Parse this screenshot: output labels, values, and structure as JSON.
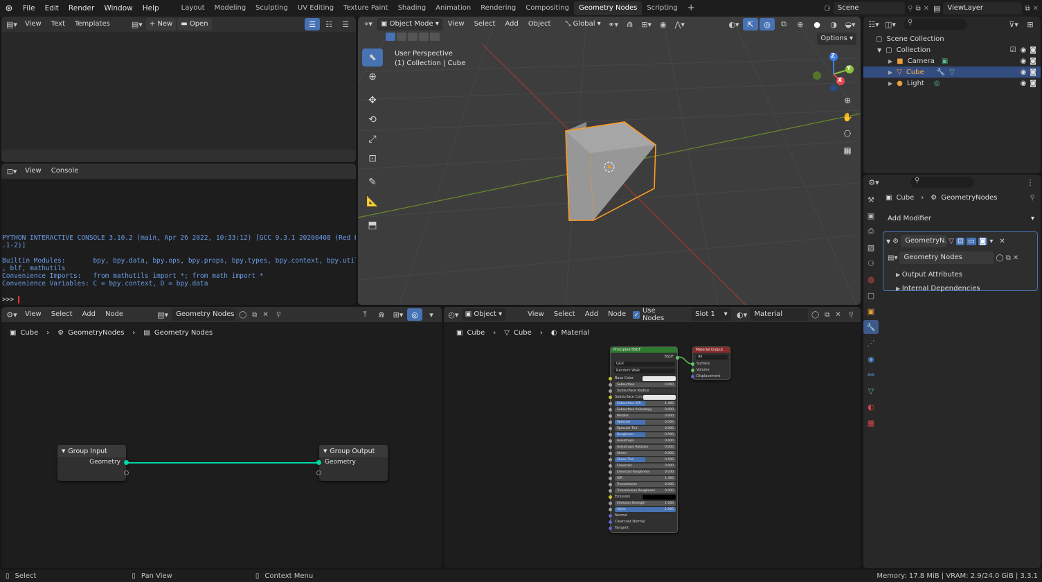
{
  "app": {
    "menus": [
      "File",
      "Edit",
      "Render",
      "Window",
      "Help"
    ],
    "workspaces": [
      "Layout",
      "Modeling",
      "Sculpting",
      "UV Editing",
      "Texture Paint",
      "Shading",
      "Animation",
      "Rendering",
      "Compositing",
      "Geometry Nodes",
      "Scripting"
    ],
    "active_workspace": "Geometry Nodes",
    "scene": "Scene",
    "view_layer": "ViewLayer",
    "add_workspace_icon": "+"
  },
  "text_editor": {
    "menus": [
      "View",
      "Text",
      "Templates"
    ],
    "new_label": "New",
    "open_label": "Open"
  },
  "console": {
    "menus": [
      "View",
      "Console"
    ],
    "lines": [
      "PYTHON INTERACTIVE CONSOLE 3.10.2 (main, Apr 26 2022, 10:33:12) [GCC 9.3.1 20200408 (Red Hat 9.3",
      ".1-2)]",
      "",
      "Builtin Modules:       bpy, bpy.data, bpy.ops, bpy.props, bpy.types, bpy.context, bpy.utils, bgl",
      ", blf, mathutils",
      "Convenience Imports:   from mathutils import *; from math import *",
      "Convenience Variables: C = bpy.context, D = bpy.data"
    ],
    "prompt": ">>>"
  },
  "viewport": {
    "mode": "Object Mode",
    "menus": [
      "View",
      "Select",
      "Add",
      "Object"
    ],
    "orientation": "Global",
    "options_label": "Options",
    "overlay_title": "User Perspective",
    "overlay_subtitle": "(1) Collection | Cube",
    "gizmo": {
      "x": "X",
      "y": "Y",
      "z": "Z"
    }
  },
  "outliner": {
    "scene_collection": "Scene Collection",
    "collection": "Collection",
    "items": [
      "Camera",
      "Cube",
      "Light"
    ],
    "selected": "Cube"
  },
  "properties": {
    "breadcrumb": [
      "Cube",
      "GeometryNodes"
    ],
    "add_modifier": "Add Modifier",
    "modifier_name": "GeometryN...",
    "node_group": "Geometry Nodes",
    "panels": [
      "Output Attributes",
      "Internal Dependencies"
    ]
  },
  "geo_editor": {
    "menus": [
      "View",
      "Select",
      "Add",
      "Node"
    ],
    "node_tree": "Geometry Nodes",
    "breadcrumb": [
      "Cube",
      "GeometryNodes",
      "Geometry Nodes"
    ],
    "group_input": {
      "title": "Group Input",
      "socket": "Geometry"
    },
    "group_output": {
      "title": "Group Output",
      "socket": "Geometry"
    }
  },
  "shader_editor": {
    "object_type": "Object",
    "menus": [
      "View",
      "Select",
      "Add",
      "Node"
    ],
    "use_nodes_label": "Use Nodes",
    "use_nodes": true,
    "slot": "Slot 1",
    "material": "Material",
    "breadcrumb": [
      "Cube",
      "Cube",
      "Material"
    ],
    "bsdf": {
      "title": "Principled BSDF",
      "output_label": "BSDF",
      "distribution": "GGX",
      "subsurface_method": "Random Walk",
      "rows": [
        {
          "label": "Base Color",
          "value": "",
          "kind": "color"
        },
        {
          "label": "Subsurface",
          "value": "0.000"
        },
        {
          "label": "Subsurface Radius",
          "value": "",
          "kind": "dd"
        },
        {
          "label": "Subsurface Colo",
          "value": "",
          "kind": "color"
        },
        {
          "label": "Subsurface IOR",
          "value": "1.400",
          "kind": "blue"
        },
        {
          "label": "Subsurface Anisotropy",
          "value": "0.000"
        },
        {
          "label": "Metallic",
          "value": "0.000"
        },
        {
          "label": "Specular",
          "value": "0.500",
          "kind": "blue"
        },
        {
          "label": "Specular Tint",
          "value": "0.000"
        },
        {
          "label": "Roughness",
          "value": "0.500",
          "kind": "blue"
        },
        {
          "label": "Anisotropic",
          "value": "0.000"
        },
        {
          "label": "Anisotropic Rotation",
          "value": "0.000"
        },
        {
          "label": "Sheen",
          "value": "0.000"
        },
        {
          "label": "Sheen Tint",
          "value": "0.500",
          "kind": "blue"
        },
        {
          "label": "Clearcoat",
          "value": "0.000"
        },
        {
          "label": "Clearcoat Roughness",
          "value": "0.030"
        },
        {
          "label": "IOR",
          "value": "1.450"
        },
        {
          "label": "Transmission",
          "value": "0.000"
        },
        {
          "label": "Transmission Roughness",
          "value": "0.000"
        },
        {
          "label": "Emission",
          "value": "",
          "kind": "black"
        },
        {
          "label": "Emission Strength",
          "value": "1.000"
        },
        {
          "label": "Alpha",
          "value": "1.000",
          "kind": "fullblue"
        },
        {
          "label": "Normal",
          "value": "",
          "kind": "text"
        },
        {
          "label": "Clearcoat Normal",
          "value": "",
          "kind": "text"
        },
        {
          "label": "Tangent",
          "value": "",
          "kind": "text"
        }
      ]
    },
    "output": {
      "title": "Material Output",
      "target": "All",
      "sockets": [
        "Surface",
        "Volume",
        "Displacement"
      ]
    }
  },
  "status": {
    "select": "Select",
    "pan": "Pan View",
    "context": "Context Menu",
    "memory": "Memory: 17.8 MiB | VRAM: 2.9/24.0 GiB | 3.3.1"
  },
  "colors": {
    "accent": "#4772b3",
    "selection": "#ff9a1f",
    "geometry_socket": "#00d6a3",
    "shader_socket": "#63c763"
  }
}
